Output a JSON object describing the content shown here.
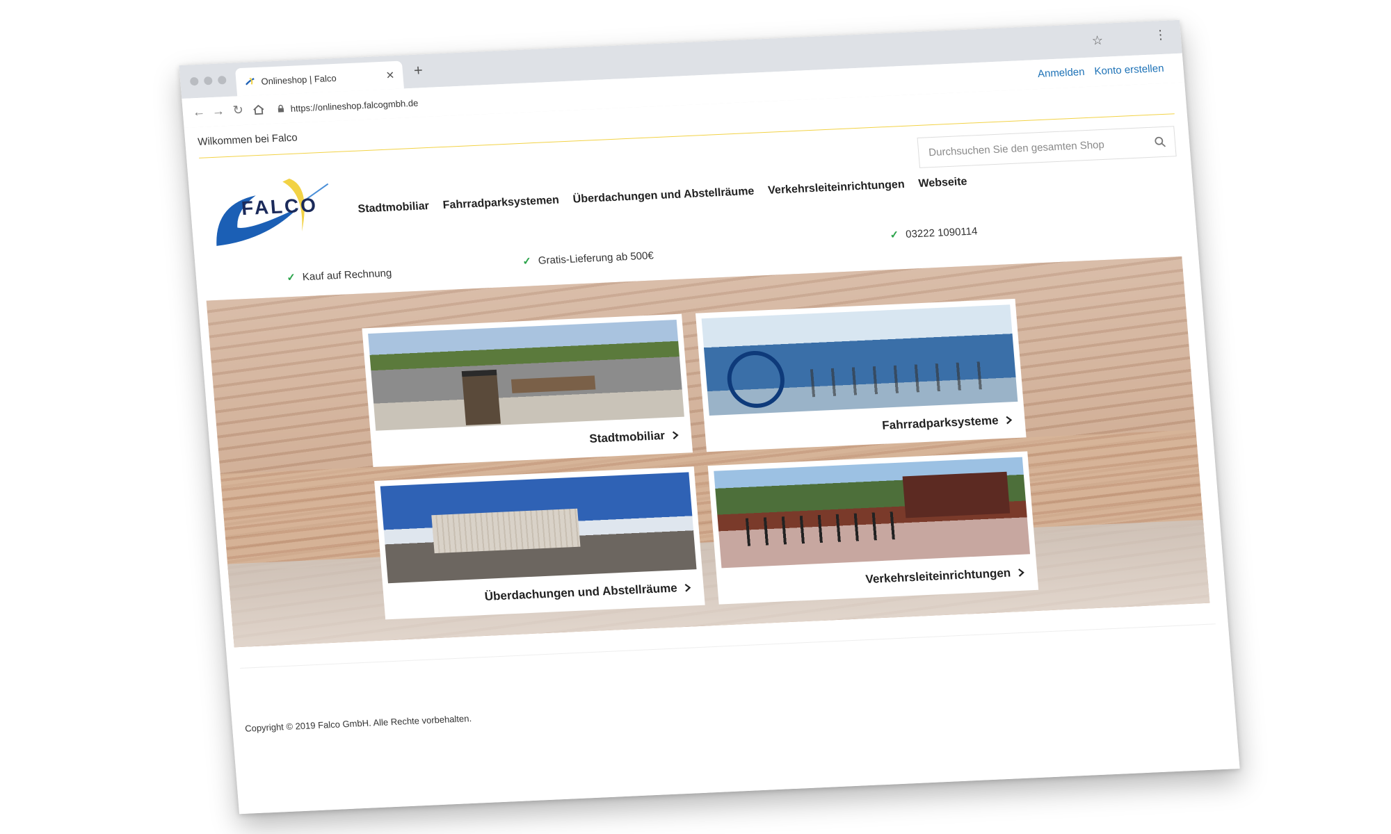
{
  "browser": {
    "tab_title": "Onlineshop | Falco",
    "url": "https://onlineshop.falcogmbh.de"
  },
  "header": {
    "welcome": "Wilkommen bei Falco",
    "signin": "Anmelden",
    "create_account": "Konto erstellen",
    "search_placeholder": "Durchsuchen Sie den gesamten Shop"
  },
  "logo": {
    "text": "FALCO"
  },
  "nav": [
    "Stadtmobiliar",
    "Fahrradparksystemen",
    "Überdachungen und Abstellräume",
    "Verkehrsleiteinrichtungen",
    "Webseite"
  ],
  "usps": [
    "Kauf auf Rechnung",
    "Gratis-Lieferung ab 500€",
    "03222 1090114"
  ],
  "cards": [
    "Stadtmobiliar",
    "Fahrradparksysteme",
    "Überdachungen und Abstellräume",
    "Verkehrsleiteinrichtungen"
  ],
  "footer": {
    "copyright": "Copyright © 2019 Falco GmbH. Alle Rechte vorbehalten."
  },
  "colors": {
    "link": "#1f73b7",
    "accent_yellow": "#f2d245",
    "check_green": "#2aa34a",
    "logo_blue": "#1b5fb5"
  }
}
